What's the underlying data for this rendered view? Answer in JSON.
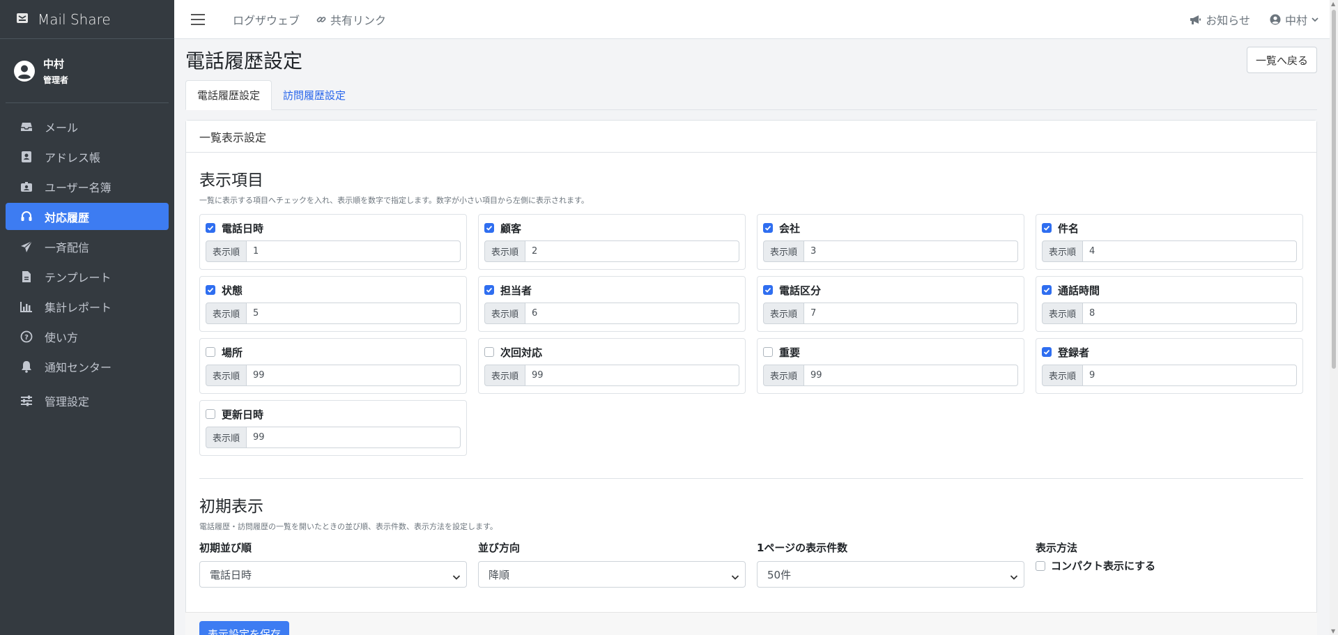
{
  "app": {
    "name": "Mail Share"
  },
  "user": {
    "name": "中村",
    "role": "管理者"
  },
  "sidebar": {
    "items": [
      {
        "label": "メール",
        "icon": "inbox-icon"
      },
      {
        "label": "アドレス帳",
        "icon": "address-book-icon"
      },
      {
        "label": "ユーザー名簿",
        "icon": "id-badge-icon"
      },
      {
        "label": "対応履歴",
        "icon": "headset-icon",
        "active": true
      },
      {
        "label": "一斉配信",
        "icon": "paper-plane-icon"
      },
      {
        "label": "テンプレート",
        "icon": "file-icon"
      },
      {
        "label": "集計レポート",
        "icon": "bar-chart-icon"
      },
      {
        "label": "使い方",
        "icon": "question-circle-icon"
      },
      {
        "label": "通知センター",
        "icon": "bell-icon"
      },
      {
        "label": "管理設定",
        "icon": "sliders-icon"
      }
    ]
  },
  "topnav": {
    "log_link": "ログザウェブ",
    "share_link": "共有リンク",
    "notice": "お知らせ",
    "user": "中村"
  },
  "page": {
    "title": "電話履歴設定",
    "back_button": "一覧へ戻る",
    "tabs": [
      {
        "label": "電話履歴設定",
        "active": true
      },
      {
        "label": "訪問履歴設定",
        "active": false
      }
    ]
  },
  "card": {
    "header": "一覧表示設定",
    "display_items": {
      "title": "表示項目",
      "description": "一覧に表示する項目へチェックを入れ、表示順を数字で指定します。数字が小さい項目から左側に表示されます。",
      "addon_label": "表示順",
      "items": [
        {
          "label": "電話日時",
          "checked": true,
          "order": "1"
        },
        {
          "label": "顧客",
          "checked": true,
          "order": "2"
        },
        {
          "label": "会社",
          "checked": true,
          "order": "3"
        },
        {
          "label": "件名",
          "checked": true,
          "order": "4"
        },
        {
          "label": "状態",
          "checked": true,
          "order": "5"
        },
        {
          "label": "担当者",
          "checked": true,
          "order": "6"
        },
        {
          "label": "電話区分",
          "checked": true,
          "order": "7"
        },
        {
          "label": "通話時間",
          "checked": true,
          "order": "8"
        },
        {
          "label": "場所",
          "checked": false,
          "order": "99"
        },
        {
          "label": "次回対応",
          "checked": false,
          "order": "99"
        },
        {
          "label": "重要",
          "checked": false,
          "order": "99"
        },
        {
          "label": "登録者",
          "checked": true,
          "order": "9"
        },
        {
          "label": "更新日時",
          "checked": false,
          "order": "99"
        }
      ]
    },
    "initial": {
      "title": "初期表示",
      "description": "電話履歴・訪問履歴の一覧を開いたときの並び順、表示件数、表示方法を設定します。",
      "sort_label": "初期並び順",
      "sort_value": "電話日時",
      "direction_label": "並び方向",
      "direction_value": "降順",
      "per_page_label": "1ページの表示件数",
      "per_page_value": "50件",
      "method_label": "表示方法",
      "compact_label": "コンパクト表示にする",
      "compact_checked": false
    },
    "save_button": "表示設定を保存"
  }
}
